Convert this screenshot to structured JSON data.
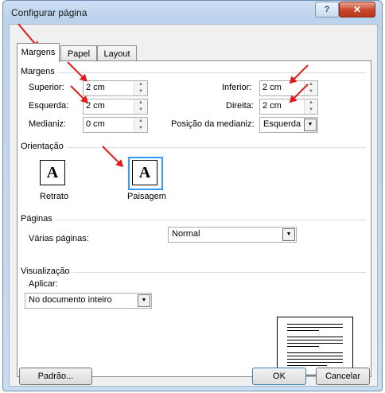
{
  "window": {
    "title": "Configurar página",
    "help_button": "?",
    "close_button": "✕"
  },
  "tabs": [
    {
      "label": "Margens",
      "active": true
    },
    {
      "label": "Papel",
      "active": false
    },
    {
      "label": "Layout",
      "active": false
    }
  ],
  "margins": {
    "section_label": "Margens",
    "superior": {
      "label": "Superior:",
      "value": "2 cm"
    },
    "esquerda": {
      "label": "Esquerda:",
      "value": "2 cm"
    },
    "medianiz": {
      "label": "Medianiz:",
      "value": "0 cm"
    },
    "inferior": {
      "label": "Inferior:",
      "value": "2 cm"
    },
    "direita": {
      "label": "Direita:",
      "value": "2 cm"
    },
    "posicao_medianiz": {
      "label": "Posição da medianiz:",
      "value": "Esquerda"
    }
  },
  "orientation": {
    "section_label": "Orientação",
    "icon_glyph": "A",
    "retrato_label": "Retrato",
    "paisagem_label": "Paisagem",
    "selected": "Paisagem"
  },
  "pages": {
    "section_label": "Páginas",
    "multiple_label": "Várias páginas:",
    "multiple_value": "Normal"
  },
  "preview": {
    "section_label": "Visualização",
    "apply_label": "Aplicar:",
    "apply_value": "No documento inteiro"
  },
  "buttons": {
    "default": "Padrão...",
    "ok": "OK",
    "cancel": "Cancelar"
  },
  "colors": {
    "annotation_arrow": "#e01b1b",
    "selected_border": "#3399ff"
  }
}
